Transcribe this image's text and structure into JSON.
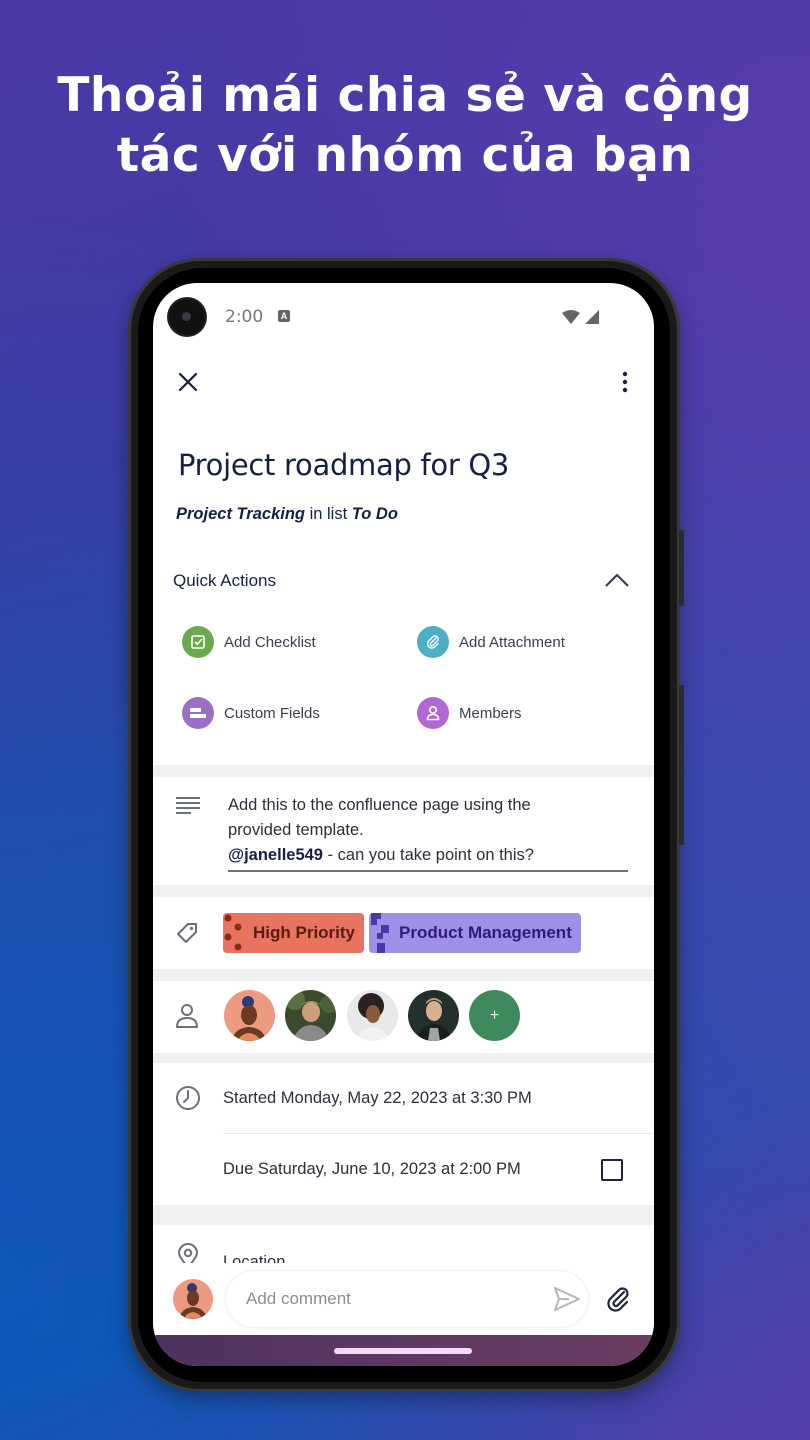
{
  "headline": {
    "line1": "Thoải mái chia sẻ và cộng",
    "line2": "tác với nhóm của bạn"
  },
  "status_bar": {
    "time": "2:00",
    "notification_icon": "A",
    "icons": [
      "wifi-icon",
      "signal-icon"
    ]
  },
  "toolbar": {
    "close_icon": "close-icon",
    "more_icon": "more-vertical-icon"
  },
  "card": {
    "title": "Project roadmap for Q3",
    "board": "Project Tracking",
    "in_list_text": "in list",
    "list": "To Do"
  },
  "quick_actions": {
    "header": "Quick Actions",
    "collapse_icon": "chevron-up-icon",
    "items": [
      {
        "label": "Add Checklist",
        "icon": "checklist-icon",
        "color": "#6aaa4f"
      },
      {
        "label": "Add Attachment",
        "icon": "paperclip-icon",
        "color": "#4bb0c4"
      },
      {
        "label": "Custom Fields",
        "icon": "custom-fields-icon",
        "color": "#9b6fc4"
      },
      {
        "label": "Members",
        "icon": "member-icon",
        "color": "#b167d4"
      }
    ]
  },
  "description": {
    "line1": "Add this to the confluence page using the",
    "line2": "provided template.",
    "mention": "@janelle549",
    "line3_rest": " - can you take point on this?"
  },
  "labels": [
    {
      "text": "High Priority",
      "color": "#e8735e"
    },
    {
      "text": "Product Management",
      "color": "#9f8fe8"
    }
  ],
  "members": {
    "avatars": [
      "member-1",
      "member-2",
      "member-3",
      "member-4"
    ],
    "add_label": "+"
  },
  "dates": {
    "started": "Started Monday, May 22, 2023 at 3:30 PM",
    "due": "Due Saturday, June 10, 2023 at 2:00 PM",
    "due_complete": false
  },
  "location": {
    "label": "Location"
  },
  "comment": {
    "placeholder": "Add comment"
  }
}
